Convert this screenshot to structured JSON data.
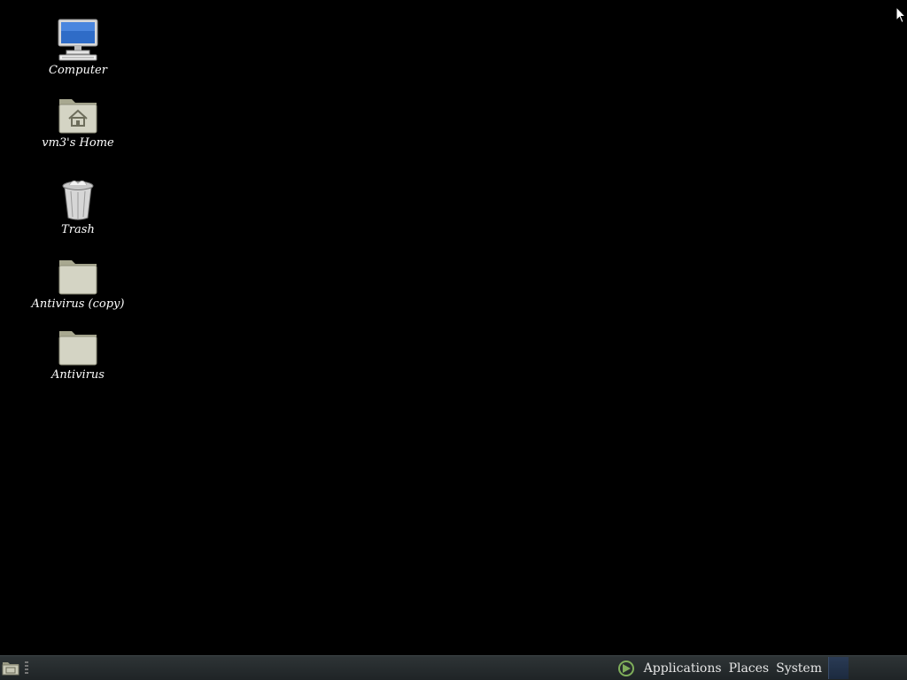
{
  "desktop": {
    "icons": [
      {
        "label": "Computer",
        "icon": "computer-icon"
      },
      {
        "label": "vm3's Home",
        "icon": "home-folder-icon"
      },
      {
        "label": "Trash",
        "icon": "trash-icon"
      },
      {
        "label": "Antivirus (copy)",
        "icon": "folder-icon"
      },
      {
        "label": "Antivirus",
        "icon": "folder-icon"
      }
    ],
    "background_color": "#000000"
  },
  "panel": {
    "menus": [
      "Applications",
      "Places",
      "System"
    ],
    "logo_icon": "distro-logo-icon",
    "show_desktop_icon": "show-desktop-icon",
    "background_color": "#2a2f31",
    "text_color": "#e6e6e6"
  }
}
